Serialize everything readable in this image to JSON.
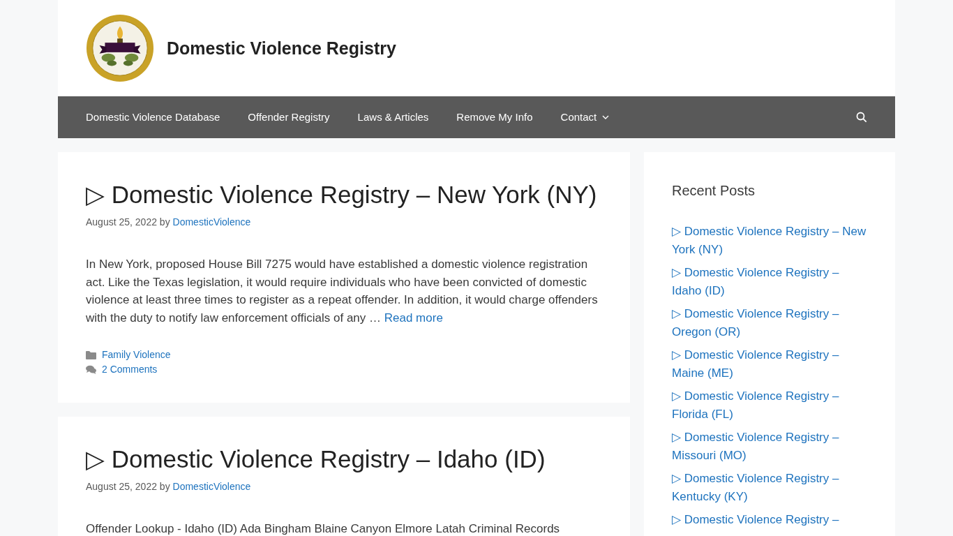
{
  "site": {
    "title": "Domestic Violence Registry"
  },
  "nav": {
    "items": [
      {
        "label": "Domestic Violence Database",
        "has_submenu": false
      },
      {
        "label": "Offender Registry",
        "has_submenu": false
      },
      {
        "label": "Laws & Articles",
        "has_submenu": false
      },
      {
        "label": "Remove My Info",
        "has_submenu": false
      },
      {
        "label": "Contact",
        "has_submenu": true
      }
    ]
  },
  "posts": [
    {
      "title": "▷ Domestic Violence Registry – New York (NY)",
      "date": "August 25, 2022",
      "by": "by",
      "author": "DomesticViolence",
      "excerpt": "In New York, proposed House Bill 7275 would have established a domestic violence registration act. Like the Texas legislation, it would require individuals who have been convicted of domestic violence at least three times to register as a repeat offender. In addition, it would  charge offenders with the duty to notify law enforcement officials of any …",
      "read_more": "Read more",
      "category": "Family Violence",
      "comments": "2 Comments"
    },
    {
      "title": "▷ Domestic Violence Registry – Idaho (ID)",
      "date": "August 25, 2022",
      "by": "by",
      "author": "DomesticViolence",
      "excerpt": "Offender Lookup - Idaho (ID) Ada Bingham Blaine Canyon Elmore Latah Criminal Records"
    }
  ],
  "sidebar": {
    "heading": "Recent Posts",
    "links": [
      "▷ Domestic Violence Registry – New York (NY)",
      "▷ Domestic Violence Registry – Idaho (ID)",
      "▷ Domestic Violence Registry – Oregon (OR)",
      "▷ Domestic Violence Registry – Maine (ME)",
      "▷ Domestic Violence Registry – Florida (FL)",
      "▷ Domestic Violence Registry – Missouri (MO)",
      "▷ Domestic Violence Registry – Kentucky (KY)",
      "▷ Domestic Violence Registry –"
    ]
  }
}
